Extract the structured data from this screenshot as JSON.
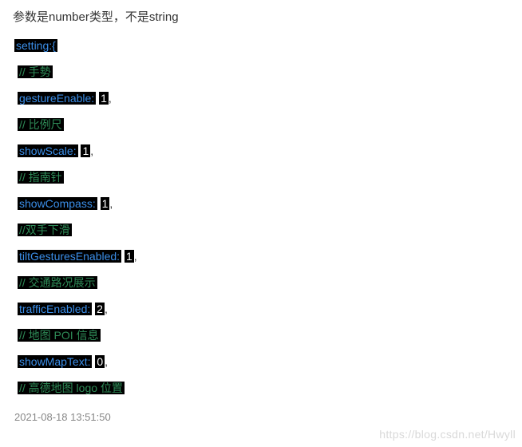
{
  "heading": "参数是number类型，不是string",
  "code": {
    "open": "setting:{",
    "lines": [
      {
        "type": "comment",
        "text": "// 手勢"
      },
      {
        "type": "kv",
        "key": "gestureEnable:",
        "val": "1",
        "after": ","
      },
      {
        "type": "comment",
        "text": "// 比例尺"
      },
      {
        "type": "kv",
        "key": "showScale:",
        "val": "1",
        "after": ","
      },
      {
        "type": "comment",
        "text": "// 指南针"
      },
      {
        "type": "kv",
        "key": "showCompass:",
        "val": "1",
        "after": ","
      },
      {
        "type": "comment",
        "text": "//双手下滑"
      },
      {
        "type": "kv",
        "key": "tiltGesturesEnabled:",
        "val": "1",
        "after": ","
      },
      {
        "type": "comment",
        "text": "// 交通路况展示"
      },
      {
        "type": "kv",
        "key": "trafficEnabled:",
        "val": "2",
        "after": ","
      },
      {
        "type": "comment",
        "text": "// 地图 POI 信息"
      },
      {
        "type": "kv",
        "key": "showMapText:",
        "val": "0",
        "after": ","
      },
      {
        "type": "comment",
        "text": "// 高德地图 logo 位置"
      }
    ]
  },
  "timestamp": "2021-08-18 13:51:50",
  "watermark": "https://blog.csdn.net/Hwyll"
}
